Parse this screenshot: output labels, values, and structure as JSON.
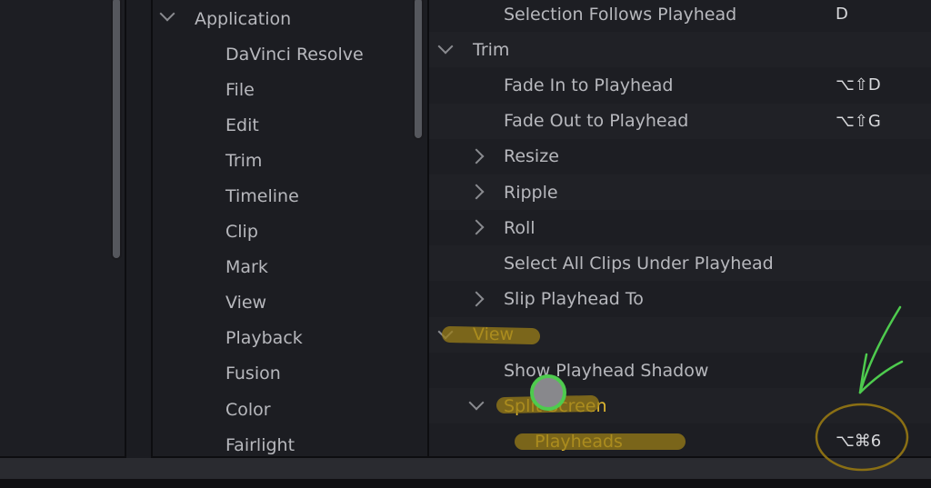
{
  "categories_panel": {
    "root": "Application",
    "items": [
      "DaVinci Resolve",
      "File",
      "Edit",
      "Trim",
      "Timeline",
      "Clip",
      "Mark",
      "View",
      "Playback",
      "Fusion",
      "Color",
      "Fairlight"
    ]
  },
  "commands_panel": {
    "rows": [
      {
        "label": "Selection Follows Playhead",
        "level": 2,
        "shortcut": "D"
      },
      {
        "label": "Trim",
        "level": 1,
        "expander": "down"
      },
      {
        "label": "Fade In to Playhead",
        "level": 2,
        "shortcut": "⌥⇧D"
      },
      {
        "label": "Fade Out to Playhead",
        "level": 2,
        "shortcut": "⌥⇧G"
      },
      {
        "label": "Resize",
        "level": 2,
        "expander": "right"
      },
      {
        "label": "Ripple",
        "level": 2,
        "expander": "right"
      },
      {
        "label": "Roll",
        "level": 2,
        "expander": "right"
      },
      {
        "label": "Select All Clips Under Playhead",
        "level": 2
      },
      {
        "label": "Slip Playhead To",
        "level": 2,
        "expander": "right"
      },
      {
        "label": "View",
        "level": 1,
        "expander": "down",
        "highlighted": true
      },
      {
        "label": "Show Playhead Shadow",
        "level": 2
      },
      {
        "label": "Split Screen",
        "level": 2,
        "expander": "down",
        "highlighted": true
      },
      {
        "label": "Playheads",
        "level": 3,
        "shortcut": "⌥⌘6",
        "highlighted": true
      }
    ]
  },
  "colors": {
    "highlight": "#e0b830",
    "annotation_green": "#4ecb4e",
    "text": "#b7b8bd"
  }
}
